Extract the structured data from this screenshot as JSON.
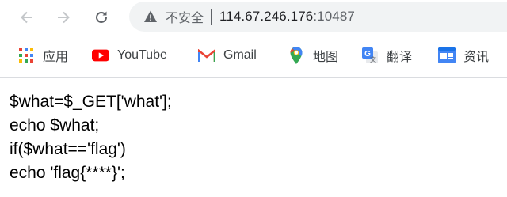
{
  "nav": {
    "back_icon": "arrow-left-icon",
    "forward_icon": "arrow-right-icon",
    "reload_icon": "reload-icon"
  },
  "address_bar": {
    "security_icon": "warning-triangle-icon",
    "security_label": "不安全",
    "host": "114.67.246.176",
    "port": ":10487"
  },
  "bookmarks": [
    {
      "label": "应用",
      "icon": "apps-grid-icon"
    },
    {
      "label": "YouTube",
      "icon": "youtube-icon"
    },
    {
      "label": "Gmail",
      "icon": "gmail-icon"
    },
    {
      "label": "地图",
      "icon": "maps-pin-icon"
    },
    {
      "label": "翻译",
      "icon": "translate-icon"
    },
    {
      "label": "资讯",
      "icon": "news-icon"
    }
  ],
  "page": {
    "lines": [
      "$what=$_GET['what'];",
      "echo $what;",
      "if($what=='flag')",
      "echo 'flag{****}';"
    ]
  },
  "colors": {
    "youtube_red": "#ff0000",
    "omnibox_bg": "#f1f3f4",
    "icon_gray": "#5f6368"
  }
}
